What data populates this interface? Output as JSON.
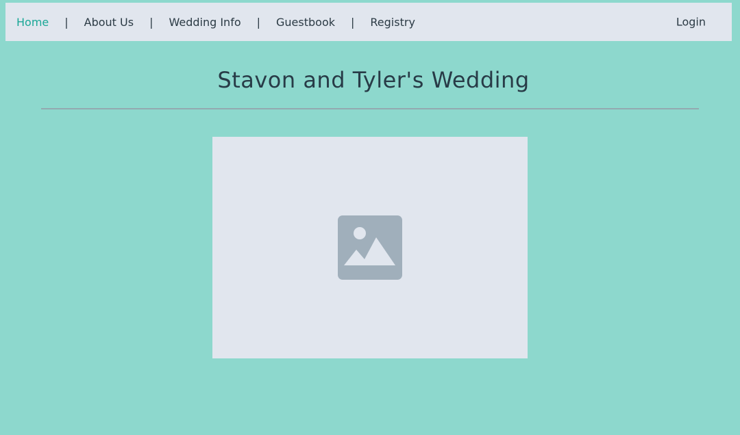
{
  "nav": {
    "links": [
      {
        "label": "Home",
        "active": true
      },
      {
        "label": "About Us"
      },
      {
        "label": "Wedding Info"
      },
      {
        "label": "Guestbook"
      },
      {
        "label": "Registry"
      }
    ],
    "separator": "|",
    "login_label": "Login"
  },
  "main": {
    "title": "Stavon and Tyler's Wedding",
    "hero_image_icon": "image-placeholder-icon"
  },
  "colors": {
    "background": "#8dd8cd",
    "navbar": "#e1e6ee",
    "accent": "#1aa796",
    "text": "#2b3a44",
    "placeholder_icon": "#a0afbb"
  }
}
